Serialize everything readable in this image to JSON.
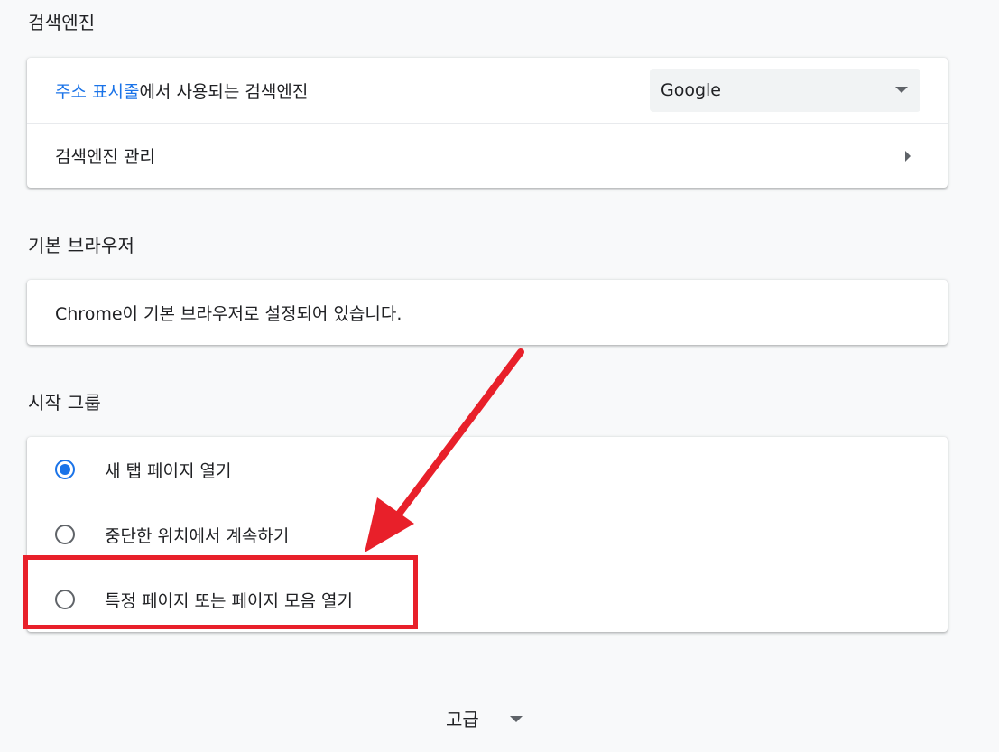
{
  "search_engine": {
    "title": "검색엔진",
    "address_bar_link": "주소 표시줄",
    "address_bar_rest": "에서 사용되는 검색엔진",
    "selected_engine": "Google",
    "manage_label": "검색엔진 관리"
  },
  "default_browser": {
    "title": "기본 브라우저",
    "status": "Chrome이 기본 브라우저로 설정되어 있습니다."
  },
  "startup": {
    "title": "시작 그룹",
    "options": [
      {
        "label": "새 탭 페이지 열기",
        "checked": true
      },
      {
        "label": "중단한 위치에서 계속하기",
        "checked": false
      },
      {
        "label": "특정 페이지 또는 페이지 모음 열기",
        "checked": false
      }
    ]
  },
  "advanced": {
    "label": "고급"
  },
  "annotation": {
    "color": "#e8202a"
  }
}
